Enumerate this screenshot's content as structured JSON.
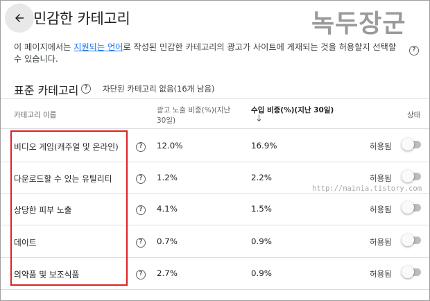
{
  "header": {
    "title": "민감한 카테고리",
    "watermark_logo": "녹두장군"
  },
  "intro": {
    "before_link": "이 페이지에서는 ",
    "link": "지원되는 언어",
    "after_link": "로 작성된 민감한 카테고리의 광고가 사이트에 게재되는 것을 허용할지 선택할",
    "line2": "수 있습니다."
  },
  "section": {
    "title": "표준 카테고리",
    "subtitle": "차단된 카테고리 없음(16개 남음)"
  },
  "table": {
    "columns": {
      "category": "카테고리 이름",
      "impressions_line1": "광고 노출 비중(%)(지난",
      "impressions_line2": "30일)",
      "revenue": "수입 비중(%)(지난 30일)",
      "status": "상태"
    },
    "rows": [
      {
        "name": "비디오 게임(캐주얼 및 온라인)",
        "impressions": "12.0%",
        "revenue": "16.9%",
        "status": "허용됨",
        "enabled": false
      },
      {
        "name": "다운로드할 수 있는 유틸리티",
        "impressions": "1.2%",
        "revenue": "2.2%",
        "status": "허용됨",
        "enabled": false
      },
      {
        "name": "상당한 피부 노출",
        "impressions": "4.1%",
        "revenue": "1.5%",
        "status": "허용됨",
        "enabled": false
      },
      {
        "name": "데이트",
        "impressions": "0.7%",
        "revenue": "0.9%",
        "status": "허용됨",
        "enabled": false
      },
      {
        "name": "의약품 및 보조식품",
        "impressions": "2.7%",
        "revenue": "0.9%",
        "status": "허용됨",
        "enabled": false
      }
    ]
  },
  "watermark_url": "http://mainia.tistory.com",
  "colors": {
    "link": "#1a73e8",
    "highlight": "#e02020",
    "toggle_track": "#bdbdbd"
  },
  "icons": {
    "back": "arrow-left-icon",
    "help": "help-circle-icon",
    "sort": "arrow-down-icon"
  }
}
